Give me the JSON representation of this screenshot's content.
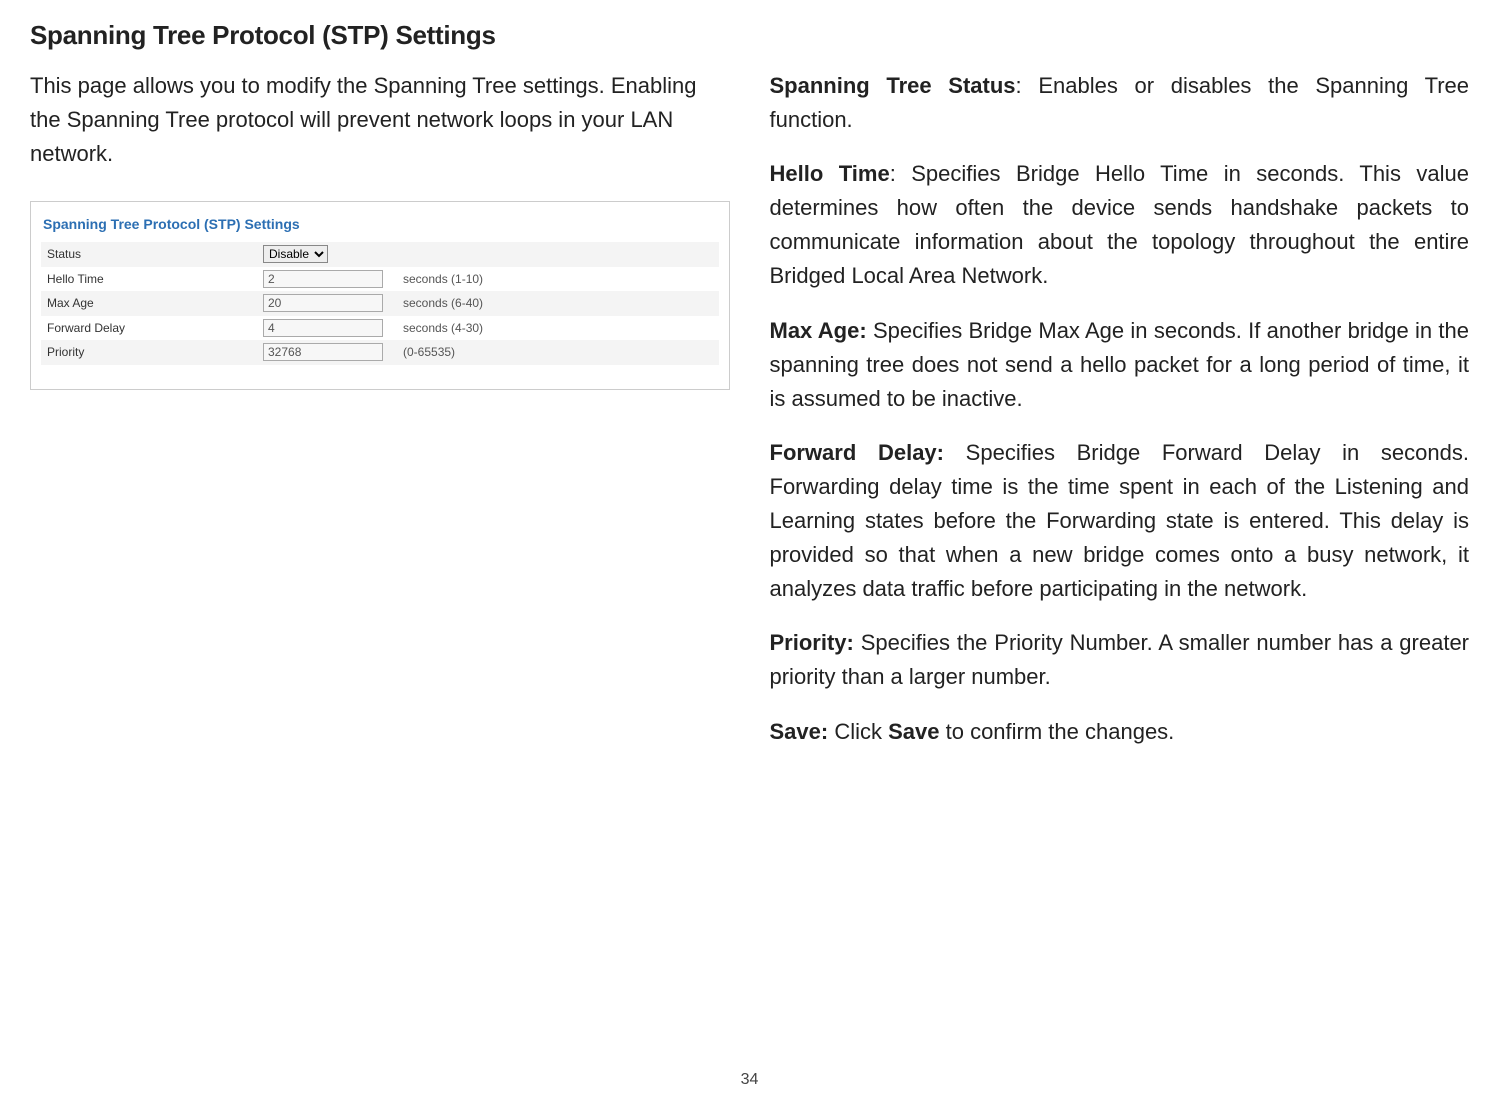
{
  "title": "Spanning Tree Protocol (STP) Settings",
  "intro": "This page allows you to modify the Spanning Tree settings. Enabling the Spanning Tree protocol will prevent network loops in your LAN network.",
  "panel": {
    "heading": "Spanning Tree Protocol (STP) Settings",
    "rows": {
      "status": {
        "label": "Status",
        "value": "Disable",
        "hint": ""
      },
      "hello": {
        "label": "Hello Time",
        "value": "2",
        "hint": "seconds (1-10)"
      },
      "maxage": {
        "label": "Max Age",
        "value": "20",
        "hint": "seconds (6-40)"
      },
      "fwd": {
        "label": "Forward Delay",
        "value": "4",
        "hint": "seconds (4-30)"
      },
      "prio": {
        "label": "Priority",
        "value": "32768",
        "hint": "(0-65535)"
      }
    }
  },
  "desc": {
    "status_label": "Spanning Tree Status",
    "status_text": ": Enables or disables the Spanning Tree function.",
    "hello_label": "Hello Time",
    "hello_text": ": Specifies Bridge Hello Time in seconds. This value determines how often the device sends handshake packets to communicate information about the topology throughout the entire Bridged Local Area Network.",
    "maxage_label": "Max Age:",
    "maxage_text": " Specifies Bridge Max Age in seconds. If another bridge in the spanning tree does not send a hello packet for a long period of time, it is assumed to be inactive.",
    "fwd_label": "Forward Delay:",
    "fwd_text": " Specifies Bridge Forward Delay in seconds. Forwarding delay time is the time spent in each of the Listening and Learning states before the Forwarding state is entered. This delay is provided so that when a new bridge comes onto a busy network, it analyzes data traffic before participating in the network.",
    "prio_label": "Priority:",
    "prio_text": " Specifies the Priority Number. A smaller number has a greater priority than a larger number.",
    "save_label": "Save:",
    "save_mid": " Click ",
    "save_bold": "Save",
    "save_end": " to confirm the changes."
  },
  "page_number": "34"
}
